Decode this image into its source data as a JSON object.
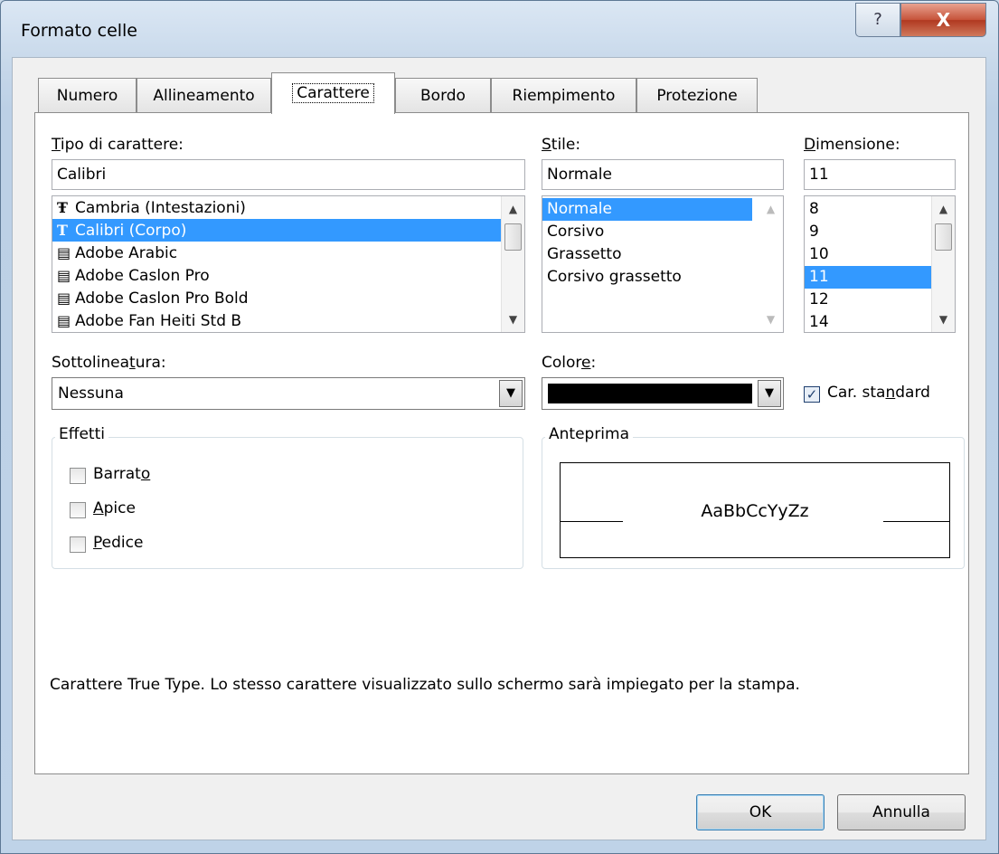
{
  "window": {
    "title": "Formato celle",
    "help_glyph": "?",
    "close_glyph": "X"
  },
  "tabs": [
    {
      "label": "Numero"
    },
    {
      "label": "Allineamento"
    },
    {
      "label": "Carattere"
    },
    {
      "label": "Bordo"
    },
    {
      "label": "Riempimento"
    },
    {
      "label": "Protezione"
    }
  ],
  "font": {
    "label_first": "T",
    "label_rest": "ipo di carattere:",
    "value": "Calibri",
    "items": [
      {
        "label": "Cambria (Intestazioni)",
        "icon": "opentype-icon"
      },
      {
        "label": "Calibri (Corpo)",
        "icon": "opentype-icon"
      },
      {
        "label": "Adobe Arabic",
        "icon": "printer-font-icon"
      },
      {
        "label": "Adobe Caslon Pro",
        "icon": "printer-font-icon"
      },
      {
        "label": "Adobe Caslon Pro Bold",
        "icon": "printer-font-icon"
      },
      {
        "label": "Adobe Fan Heiti Std B",
        "icon": "printer-font-icon"
      }
    ]
  },
  "style": {
    "label_first": "S",
    "label_rest": "tile:",
    "value": "Normale",
    "items": [
      "Normale",
      "Corsivo",
      "Grassetto",
      "Corsivo grassetto"
    ]
  },
  "size": {
    "label_first": "D",
    "label_rest": "imensione:",
    "value": "11",
    "items": [
      "8",
      "9",
      "10",
      "11",
      "12",
      "14"
    ]
  },
  "underline": {
    "label_a": "Sottolinea",
    "label_u": "t",
    "label_b": "ura:",
    "value": "Nessuna"
  },
  "color": {
    "label_a": "Color",
    "label_u": "e",
    "label_b": ":",
    "swatch": "#000000"
  },
  "standard": {
    "label_a": "Car. sta",
    "label_u": "n",
    "label_b": "dard",
    "checked": true
  },
  "effects": {
    "legend": "Effetti",
    "strike": {
      "a": "Barrat",
      "u": "o",
      "b": ""
    },
    "super": {
      "a": "",
      "u": "A",
      "b": "pice"
    },
    "sub": {
      "a": "",
      "u": "P",
      "b": "edice"
    }
  },
  "preview": {
    "legend": "Anteprima",
    "sample": "AaBbCcYyZz"
  },
  "description": "Carattere True Type. Lo stesso carattere visualizzato sullo schermo sarà impiegato per la stampa.",
  "buttons": {
    "ok": "OK",
    "cancel": "Annulla"
  },
  "colors": {
    "selection": "#3399ff",
    "panel": "#ffffff",
    "dialog": "#f0f0f0"
  }
}
